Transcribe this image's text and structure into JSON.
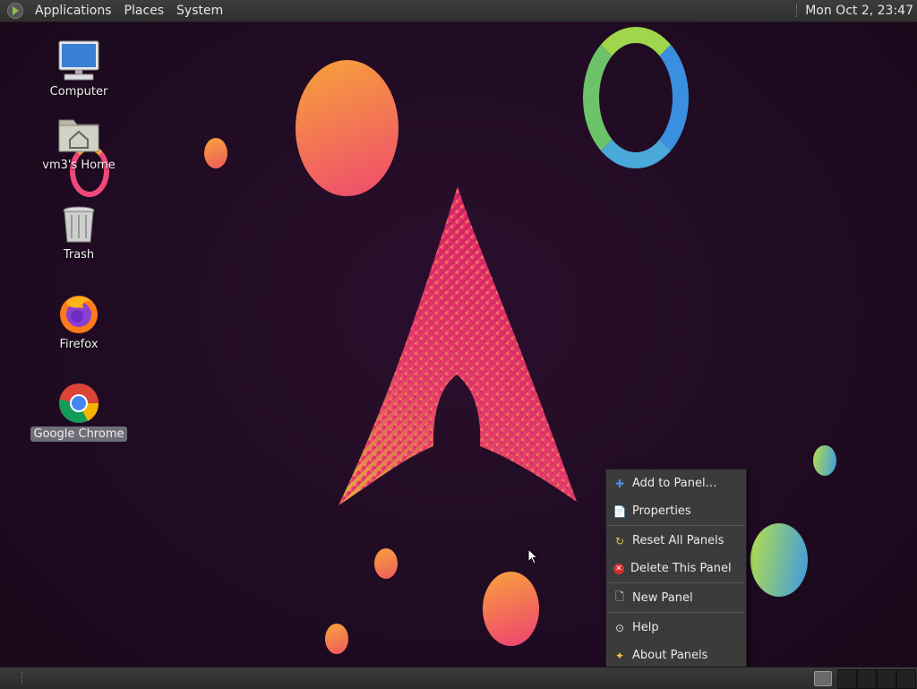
{
  "top_panel": {
    "menus": [
      "Applications",
      "Places",
      "System"
    ],
    "clock": "Mon Oct  2, 23:47"
  },
  "desktop_icons": [
    {
      "label": "Computer",
      "icon": "computer-icon"
    },
    {
      "label": "vm3's Home",
      "icon": "home-folder-icon"
    },
    {
      "label": "Trash",
      "icon": "trash-icon"
    },
    {
      "label": "Firefox",
      "icon": "firefox-icon"
    },
    {
      "label": "Google Chrome",
      "icon": "chrome-icon",
      "selected": true
    }
  ],
  "context_menu": {
    "items": [
      {
        "label": "Add to Panel…",
        "icon": "plus-icon"
      },
      {
        "label": "Properties",
        "icon": "properties-icon"
      },
      {
        "label": "Reset All Panels",
        "icon": "reset-icon"
      },
      {
        "label": "Delete This Panel",
        "icon": "delete-icon"
      },
      {
        "label": "New Panel",
        "icon": "new-panel-icon"
      },
      {
        "label": "Help",
        "icon": "help-icon"
      },
      {
        "label": "About Panels",
        "icon": "about-icon"
      }
    ]
  },
  "colors": {
    "panel": "#333333",
    "menu_bg": "#3b3b3b",
    "wallpaper": "#1f0b22",
    "accent_pink": "#e8306a",
    "accent_orange": "#f7a23a"
  }
}
